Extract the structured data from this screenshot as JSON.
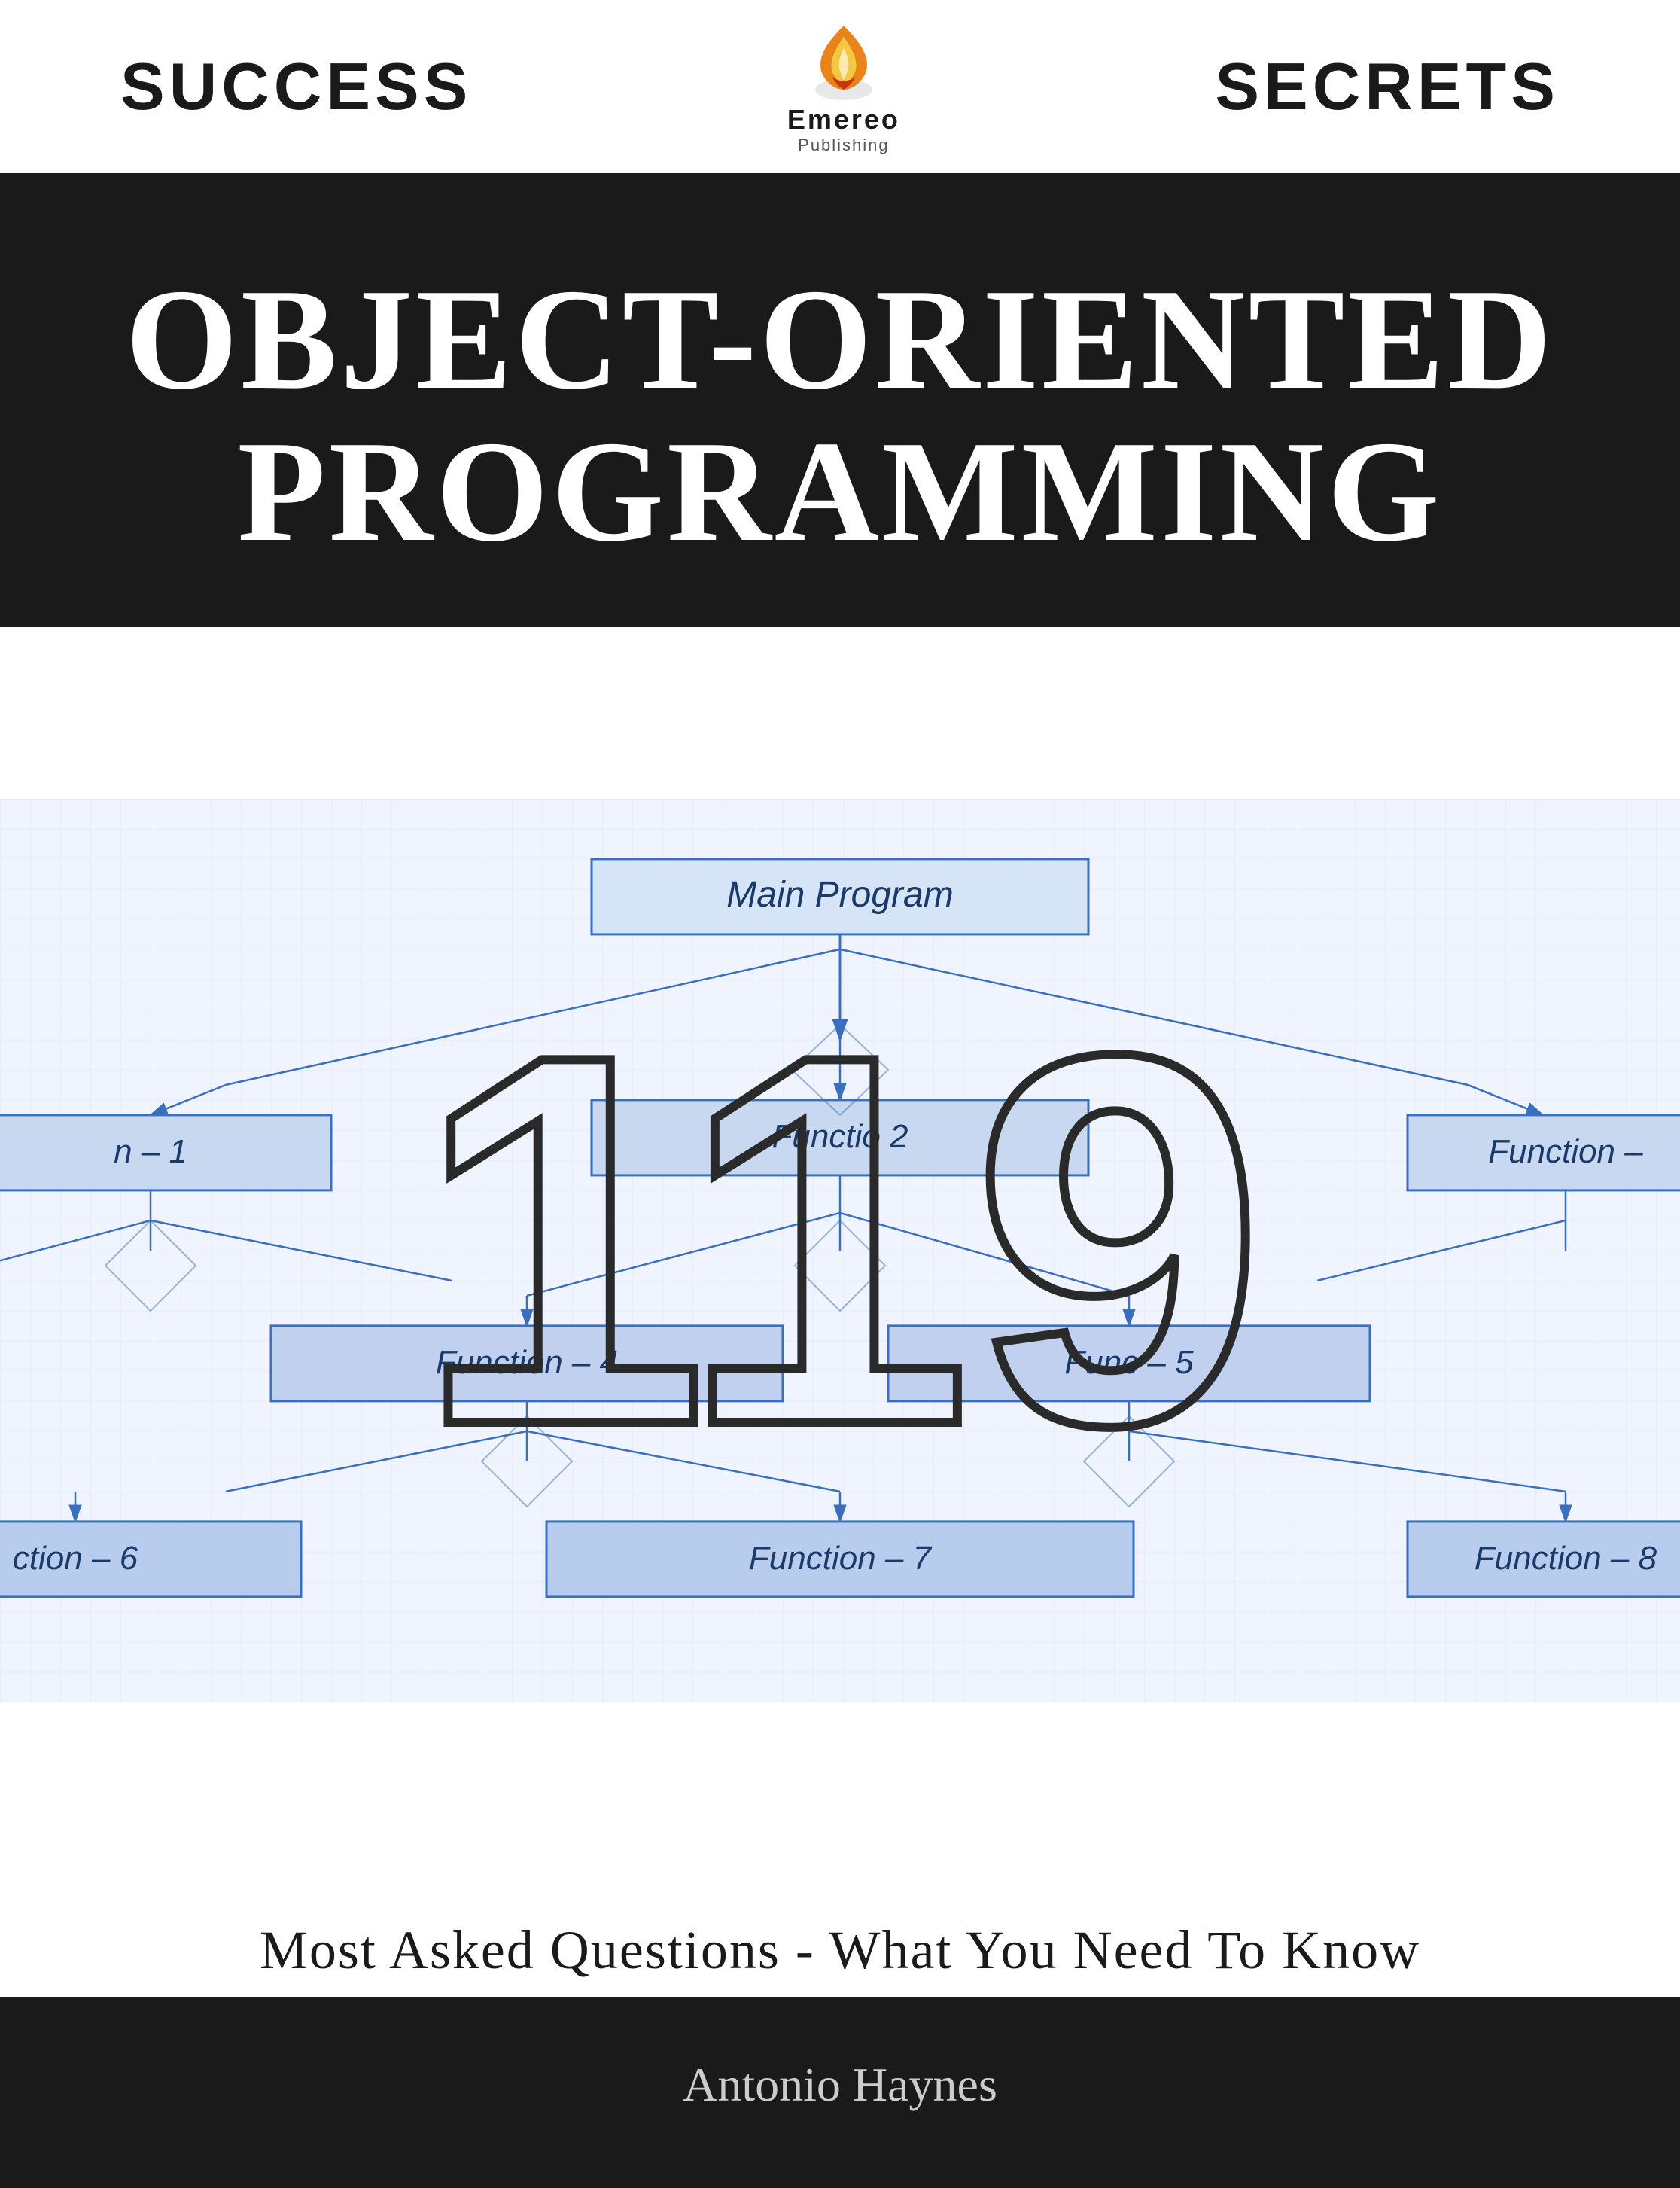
{
  "header": {
    "left_label": "SUCCESS",
    "right_label": "SECRETS",
    "logo_name": "Emereo",
    "logo_subtext": "Publishing"
  },
  "title": {
    "line1": "OBJECT-ORIENTED",
    "line2": "PROGRAMMING"
  },
  "number": {
    "value": "119"
  },
  "diagram": {
    "main_program": "Main Program",
    "functions": [
      {
        "id": "f1",
        "label": "n – 1"
      },
      {
        "id": "f2",
        "label": "Functio  2"
      },
      {
        "id": "f3",
        "label": "Function –"
      },
      {
        "id": "f4",
        "label": "Function – 4"
      },
      {
        "id": "f5",
        "label": "Func  – 5"
      },
      {
        "id": "f6",
        "label": "ction – 6"
      },
      {
        "id": "f7",
        "label": "Function – 7"
      },
      {
        "id": "f8",
        "label": "Function – 8"
      }
    ]
  },
  "subtitle": {
    "text": "Most Asked Questions - What You Need To Know"
  },
  "author": {
    "name": "Antonio Haynes"
  }
}
